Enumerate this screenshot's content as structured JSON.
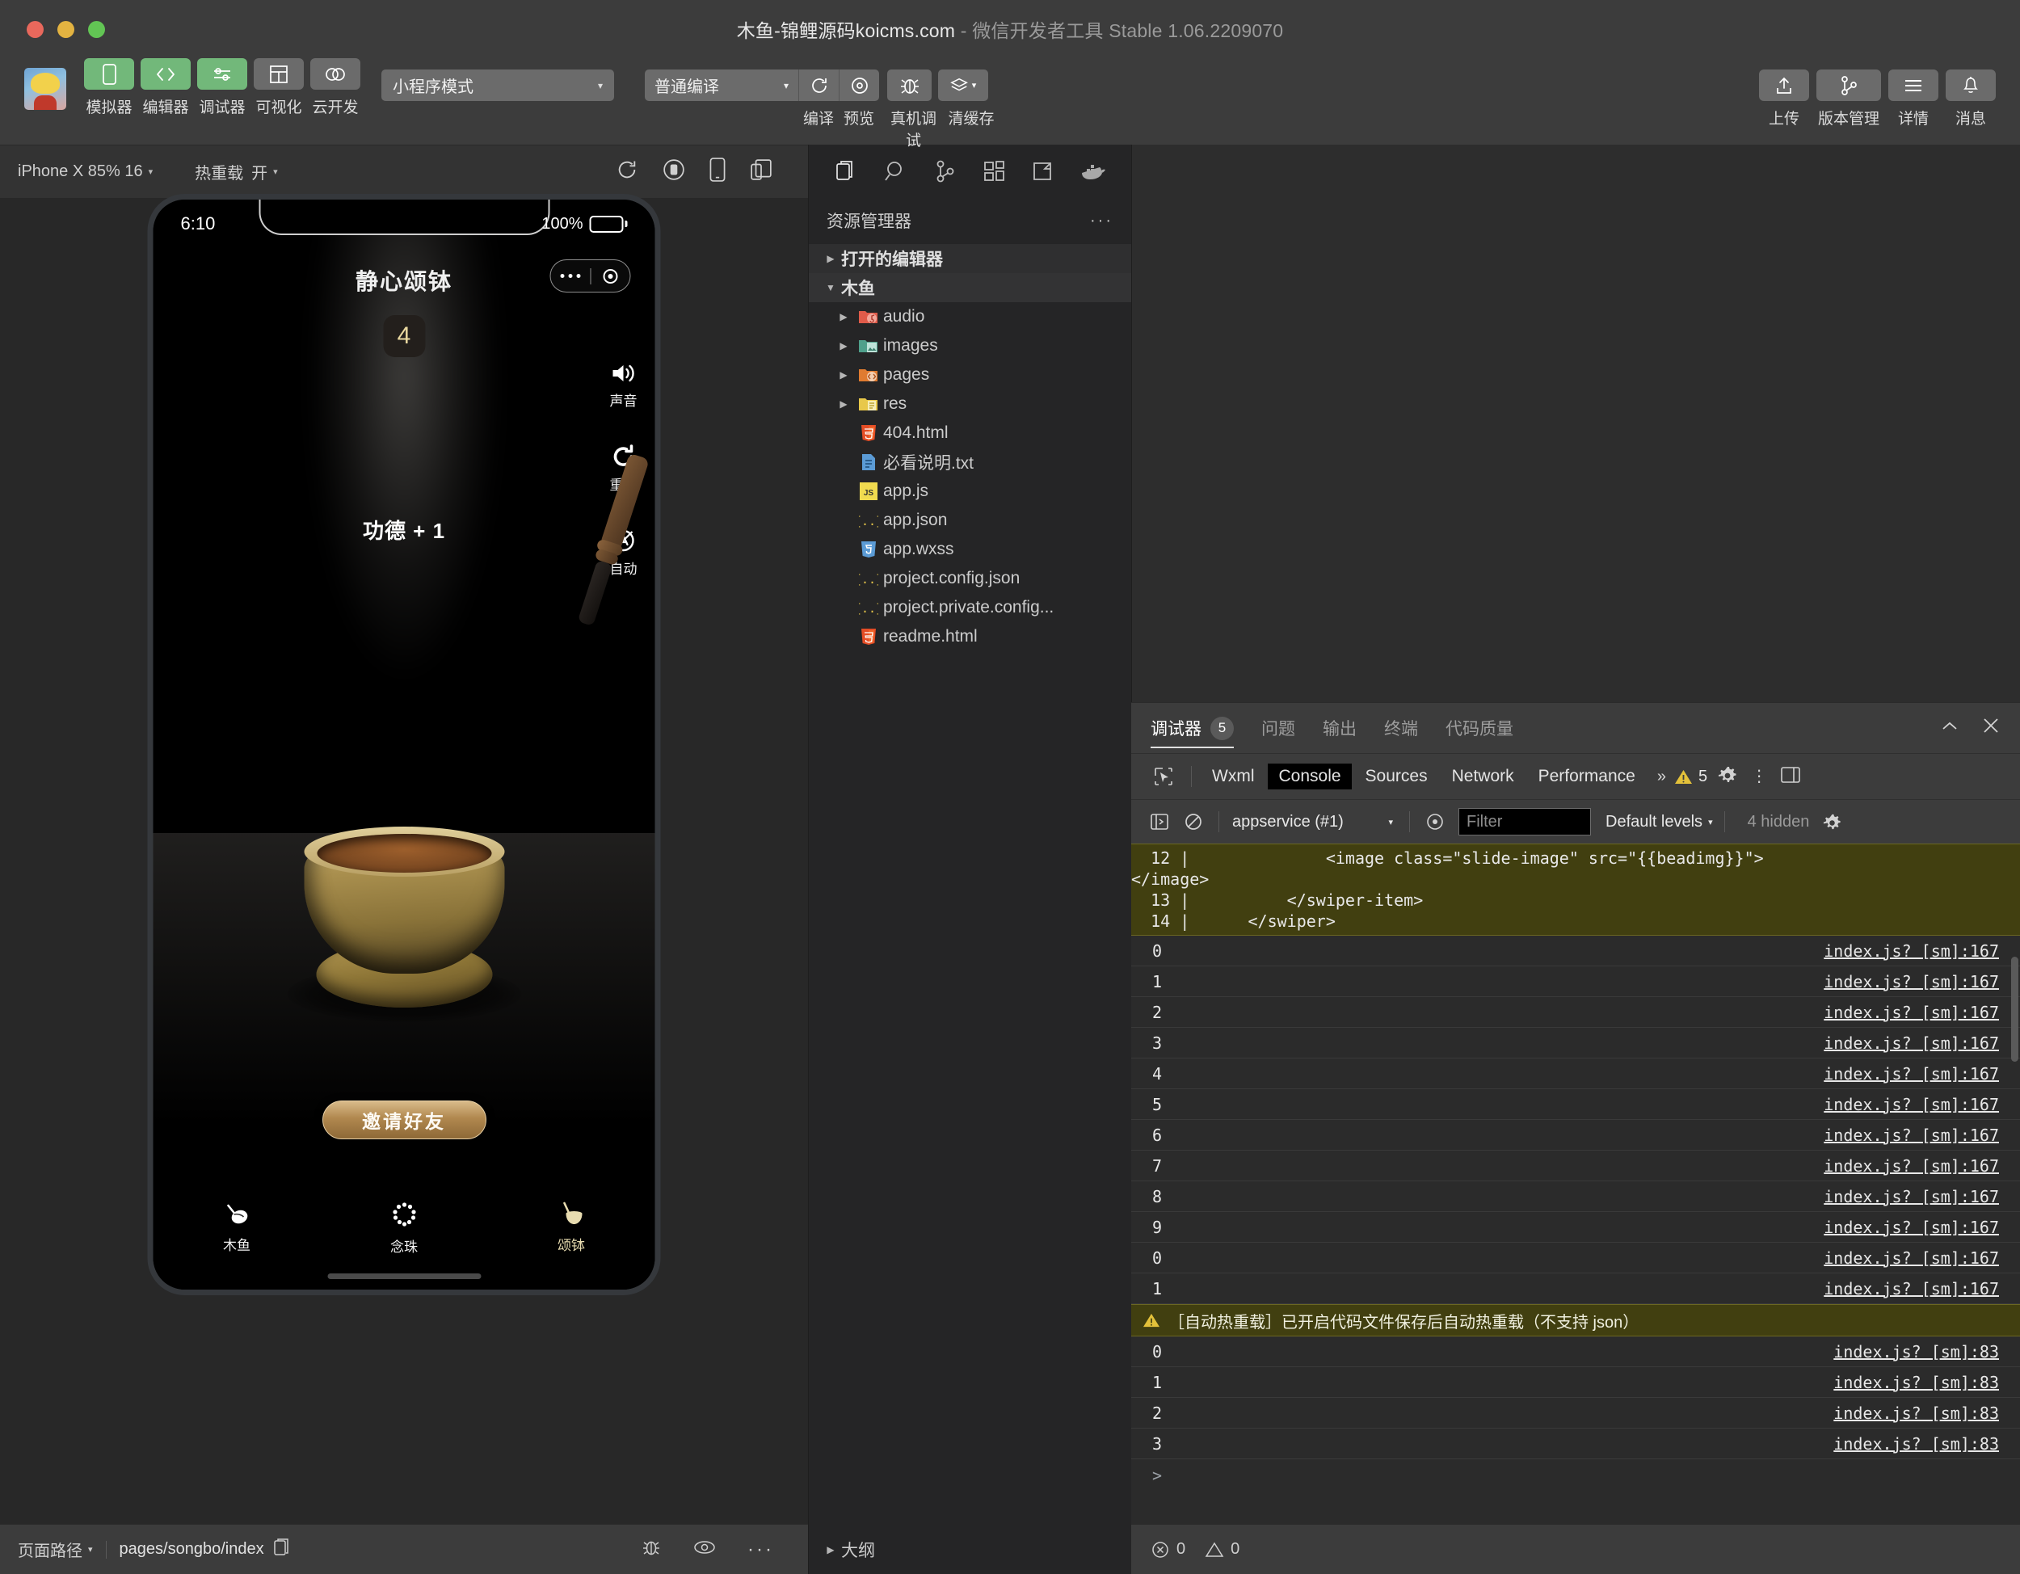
{
  "window": {
    "title_main": "木鱼-锦鲤源码koicms.com",
    "title_sep": " - ",
    "title_sub": "微信开发者工具 Stable 1.06.2209070"
  },
  "toolbar": {
    "buttons": [
      {
        "label": "模拟器",
        "icon": "phone-icon",
        "active": true
      },
      {
        "label": "编辑器",
        "icon": "code-icon",
        "active": true
      },
      {
        "label": "调试器",
        "icon": "sliders-icon",
        "active": true
      },
      {
        "label": "可视化",
        "icon": "layout-icon",
        "active": false
      },
      {
        "label": "云开发",
        "icon": "cloud-icon",
        "active": false
      }
    ],
    "mode_select": "小程序模式",
    "compile_select": "普通编译",
    "compile_labels": [
      "编译",
      "预览",
      "真机调试",
      "清缓存"
    ],
    "right_buttons": [
      {
        "label": "上传",
        "icon": "upload-icon"
      },
      {
        "label": "版本管理",
        "icon": "branch-icon"
      },
      {
        "label": "详情",
        "icon": "menu-icon"
      },
      {
        "label": "消息",
        "icon": "bell-icon"
      }
    ]
  },
  "simulator": {
    "device_select": "iPhone X 85% 16",
    "hotreload_label": "热重载",
    "hotreload_value": "开",
    "icons": [
      "refresh-icon",
      "record-icon",
      "device-icon",
      "multi-window-icon"
    ],
    "phone": {
      "time": "6:10",
      "battery": "100%",
      "app_title": "静心颂钵",
      "count": "4",
      "side_tools": [
        {
          "label": "声音",
          "icon": "speaker-icon"
        },
        {
          "label": "重置",
          "icon": "reset-icon"
        },
        {
          "label": "自动",
          "icon": "auto-icon"
        }
      ],
      "merit_text": "功德 + 1",
      "invite_button": "邀请好友",
      "tabs": [
        {
          "label": "木鱼",
          "icon": "wooden-fish-icon",
          "active": false
        },
        {
          "label": "念珠",
          "icon": "prayer-beads-icon",
          "active": false
        },
        {
          "label": "颂钵",
          "icon": "singing-bowl-icon",
          "active": true
        }
      ]
    },
    "footer": {
      "path_label": "页面路径",
      "path_value": "pages/songbo/index",
      "icons": [
        "bug-icon",
        "eye-icon",
        "more-icon"
      ]
    }
  },
  "explorer": {
    "activity_icons": [
      "files-icon",
      "search-icon",
      "source-control-icon",
      "extensions-icon",
      "debug-icon",
      "docker-icon"
    ],
    "title": "资源管理器",
    "more": "···",
    "tree": [
      {
        "label": "打开的编辑器",
        "kind": "section",
        "expanded": false,
        "depth": 0
      },
      {
        "label": "木鱼",
        "kind": "section",
        "expanded": true,
        "depth": 0,
        "selected": true
      },
      {
        "label": "audio",
        "kind": "folder",
        "icon": "folder-audio-icon",
        "expanded": false,
        "depth": 1
      },
      {
        "label": "images",
        "kind": "folder",
        "icon": "folder-images-icon",
        "expanded": false,
        "depth": 1
      },
      {
        "label": "pages",
        "kind": "folder",
        "icon": "folder-pages-icon",
        "expanded": false,
        "depth": 1
      },
      {
        "label": "res",
        "kind": "folder",
        "icon": "folder-res-icon",
        "expanded": false,
        "depth": 1
      },
      {
        "label": "404.html",
        "kind": "file",
        "icon": "html-icon",
        "depth": 1
      },
      {
        "label": "必看说明.txt",
        "kind": "file",
        "icon": "txt-icon",
        "depth": 1
      },
      {
        "label": "app.js",
        "kind": "file",
        "icon": "js-icon",
        "depth": 1
      },
      {
        "label": "app.json",
        "kind": "file",
        "icon": "json-icon",
        "depth": 1
      },
      {
        "label": "app.wxss",
        "kind": "file",
        "icon": "css-icon",
        "depth": 1
      },
      {
        "label": "project.config.json",
        "kind": "file",
        "icon": "json-icon",
        "depth": 1
      },
      {
        "label": "project.private.config...",
        "kind": "file",
        "icon": "json-icon",
        "depth": 1
      },
      {
        "label": "readme.html",
        "kind": "file",
        "icon": "html-icon",
        "depth": 1
      }
    ],
    "outline": "大纲"
  },
  "devtools": {
    "panel_tabs": [
      {
        "label": "调试器",
        "badge": "5",
        "active": true
      },
      {
        "label": "问题",
        "badge": "",
        "active": false
      },
      {
        "label": "输出",
        "badge": "",
        "active": false
      },
      {
        "label": "终端",
        "badge": "",
        "active": false
      },
      {
        "label": "代码质量",
        "badge": "",
        "active": false
      }
    ],
    "panel_actions": [
      "collapse-icon",
      "close-icon"
    ],
    "sub_tabs": [
      {
        "label": "Wxml",
        "active": false
      },
      {
        "label": "Console",
        "active": true
      },
      {
        "label": "Sources",
        "active": false
      },
      {
        "label": "Network",
        "active": false
      },
      {
        "label": "Performance",
        "active": false
      }
    ],
    "overflow": "»",
    "warning_count": "5",
    "console_bar": {
      "context": "appservice (#1)",
      "filter_placeholder": "Filter",
      "levels": "Default levels",
      "hidden": "4 hidden"
    },
    "code_lines": [
      "  12 |              <image class=\"slide-image\" src=\"{{beadimg}}\">",
      "</image>",
      "  13 |          </swiper-item>",
      "  14 |      </swiper>"
    ],
    "logs": [
      {
        "text": "0",
        "src": "index.js? [sm]:167"
      },
      {
        "text": "1",
        "src": "index.js? [sm]:167"
      },
      {
        "text": "2",
        "src": "index.js? [sm]:167"
      },
      {
        "text": "3",
        "src": "index.js? [sm]:167"
      },
      {
        "text": "4",
        "src": "index.js? [sm]:167"
      },
      {
        "text": "5",
        "src": "index.js? [sm]:167"
      },
      {
        "text": "6",
        "src": "index.js? [sm]:167"
      },
      {
        "text": "7",
        "src": "index.js? [sm]:167"
      },
      {
        "text": "8",
        "src": "index.js? [sm]:167"
      },
      {
        "text": "9",
        "src": "index.js? [sm]:167"
      },
      {
        "text": "0",
        "src": "index.js? [sm]:167"
      },
      {
        "text": "1",
        "src": "index.js? [sm]:167"
      }
    ],
    "warning_message": "［自动热重载］已开启代码文件保存后自动热重载（不支持 json）",
    "logs_after": [
      {
        "text": "0",
        "src": "index.js? [sm]:83"
      },
      {
        "text": "1",
        "src": "index.js? [sm]:83"
      },
      {
        "text": "2",
        "src": "index.js? [sm]:83"
      },
      {
        "text": "3",
        "src": "index.js? [sm]:83"
      }
    ],
    "prompt": ">"
  },
  "status": {
    "errors": "0",
    "warnings": "0"
  },
  "colors": {
    "accent_green": "#72b87a",
    "toolbar_bg": "#3c3c3c",
    "explorer_bg": "#252526",
    "console_bg": "#2b2b2b",
    "warn_bg": "#413f10",
    "warn_yellow": "#e3c13a",
    "gold": "#b1884f"
  }
}
